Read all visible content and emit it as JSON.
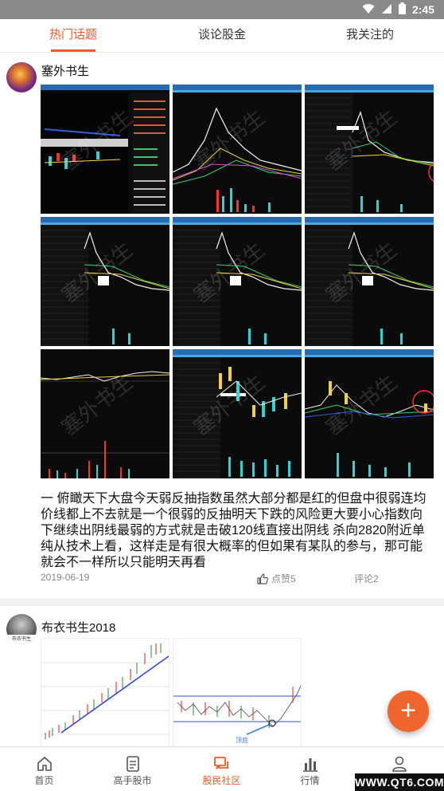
{
  "status_bar": {
    "time": "2:45",
    "icons": [
      "wifi-icon",
      "signal-icon",
      "battery-icon"
    ]
  },
  "top_tabs": [
    {
      "label": "热门话题",
      "active": true
    },
    {
      "label": "谈论股金",
      "active": false
    },
    {
      "label": "我关注的",
      "active": false
    }
  ],
  "posts": [
    {
      "author": "塞外书生",
      "image_watermark": "塞外书生",
      "image_count": 9,
      "text": "一 俯瞰天下大盘今天弱反抽指数虽然大部分都是红的但盘中很弱连均价线都上不去就是一个很弱的反抽明天下跌的风险更大要小心指数向下继续出阴线最弱的方式就是击破120线直接出阴线 杀向2820附近单纯从技术上看，这样走是有很大概率的但如果有某队的参与，那可能就会不一样所以只能明天再看",
      "date": "2019-06-19",
      "like_label": "点赞5",
      "comment_label": "评论2"
    },
    {
      "author": "布衣书生2018",
      "avatar_caption": "布衣书生",
      "image_count": 2,
      "chart_annotation": "顶底"
    }
  ],
  "fab_label": "+",
  "bottom_nav": [
    {
      "label": "首页",
      "icon": "home-icon",
      "active": false
    },
    {
      "label": "高手股市",
      "icon": "document-icon",
      "active": false
    },
    {
      "label": "股民社区",
      "icon": "chat-icon",
      "active": true
    },
    {
      "label": "行情",
      "icon": "bar-chart-icon",
      "active": false
    },
    {
      "label": "我的",
      "icon": "user-icon",
      "active": false
    }
  ],
  "corner_badge": "WWW.QT6.COM",
  "colors": {
    "accent": "#ef5a2b",
    "fab": "#f0642d",
    "status_bar": "#8a8a8a",
    "divider": "#f2f2f2"
  }
}
